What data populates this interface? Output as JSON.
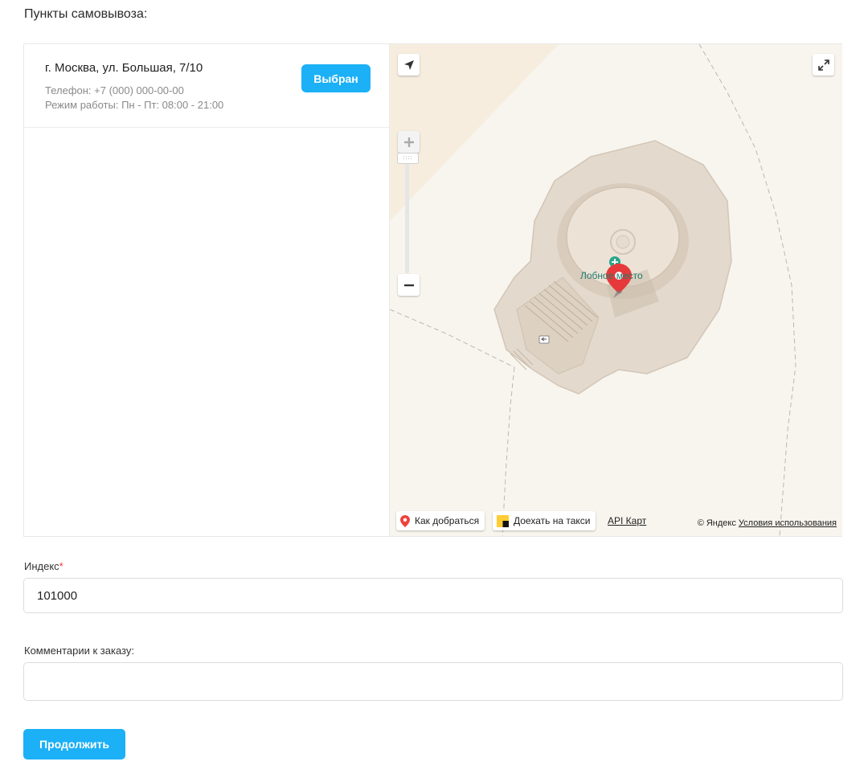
{
  "section_title": "Пункты самовывоза:",
  "pickup_point": {
    "address": "г. Москва, ул. Большая, 7/10",
    "phone": "Телефон: +7 (000) 000-00-00",
    "hours": "Режим работы: Пн - Пт: 08:00 - 21:00",
    "select_button_label": "Выбран"
  },
  "map": {
    "poi_label": "Лобное место",
    "route_label": "Как добраться",
    "taxi_label": "Доехать на такси",
    "api_link_label": "API Карт",
    "copyright": "© Яндекс",
    "terms_label": "Условия использования",
    "zoom_thumb_glyph": "::::",
    "colors": {
      "land": "#f8f5ee",
      "area": "#f6eddf",
      "building": "#e3d9cc",
      "marker": "#e6393b"
    }
  },
  "index_field": {
    "label": "Индекс",
    "required_mark": "*",
    "value": "101000"
  },
  "comment_field": {
    "label": "Комментарии к заказу:",
    "value": "",
    "placeholder": ""
  },
  "continue_button_label": "Продолжить",
  "colors": {
    "accent": "#1cb0f6"
  }
}
